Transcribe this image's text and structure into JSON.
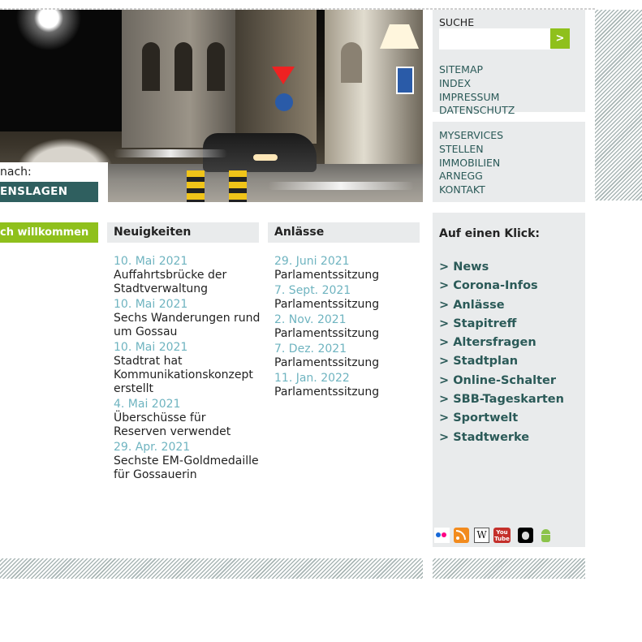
{
  "search_by": {
    "label": "nach:",
    "bar_label": "ENSLAGEN"
  },
  "service": {
    "search_title": "SUCHE",
    "search_value": "",
    "search_button": ">",
    "links": [
      "SITEMAP",
      "INDEX",
      "IMPRESSUM",
      "DATENSCHUTZ"
    ],
    "links2": [
      "MYSERVICES",
      "STELLEN",
      "IMMOBILIEN",
      "ARNEGG",
      "KONTAKT"
    ]
  },
  "welcome": "ch willkommen",
  "news": {
    "title": "Neuigkeiten",
    "items": [
      {
        "date": "10. Mai 2021",
        "text": "Auffahrtsbrücke der Stadtverwaltung"
      },
      {
        "date": "10. Mai 2021",
        "text": "Sechs Wanderungen rund um Gossau"
      },
      {
        "date": "10. Mai 2021",
        "text": "Stadtrat hat Kommunikationskonzept erstellt"
      },
      {
        "date": "4. Mai 2021",
        "text": "Überschüsse für Reserven verwendet"
      },
      {
        "date": "29. Apr. 2021",
        "text": "Sechste EM-Goldmedaille für Gossauerin"
      }
    ]
  },
  "events": {
    "title": "Anlässe",
    "items": [
      {
        "date": "29. Juni 2021",
        "text": "Parlamentssitzung"
      },
      {
        "date": "7. Sept. 2021",
        "text": "Parlamentssitzung"
      },
      {
        "date": "2. Nov. 2021",
        "text": "Parlamentssitzung"
      },
      {
        "date": "7. Dez. 2021",
        "text": "Parlamentssitzung"
      },
      {
        "date": "11. Jan. 2022",
        "text": "Parlamentssitzung"
      }
    ]
  },
  "quick": {
    "title": "Auf einen Klick:",
    "links": [
      "> News",
      "> Corona-Infos",
      "> Anlässe",
      "> Stapitreff",
      "> Altersfragen",
      "> Stadtplan",
      "> Online-Schalter",
      "> SBB-Tageskarten",
      "> Sportwelt",
      "> Stadtwerke"
    ]
  },
  "social": {
    "icons": [
      "flickr-icon",
      "rss-icon",
      "wikipedia-icon",
      "youtube-icon",
      "apple-icon",
      "android-icon"
    ],
    "wiki_letter": "W",
    "youtube_label": "You Tube"
  },
  "colors": {
    "accent_green": "#8fc01c",
    "dark_teal": "#2f5f5f",
    "link_teal": "#2b5a58",
    "date_blue": "#6fb4c0",
    "panel_grey": "#e9ebec"
  }
}
